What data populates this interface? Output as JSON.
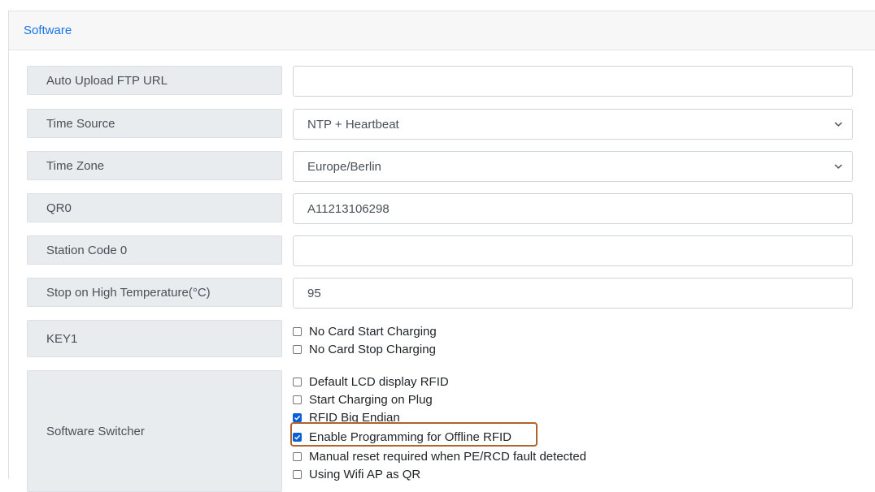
{
  "header": {
    "title": "Software"
  },
  "fields": {
    "ftp": {
      "label": "Auto Upload FTP URL",
      "value": ""
    },
    "time_source": {
      "label": "Time Source",
      "value": "NTP + Heartbeat"
    },
    "time_zone": {
      "label": "Time Zone",
      "value": "Europe/Berlin"
    },
    "qr0": {
      "label": "QR0",
      "value": "A11213106298"
    },
    "station_code": {
      "label": "Station Code 0",
      "value": ""
    },
    "stop_temp": {
      "label": "Stop on High Temperature(°C)",
      "value": "95"
    }
  },
  "key1": {
    "label": "KEY1",
    "options": [
      {
        "label": "No Card Start Charging",
        "checked": false
      },
      {
        "label": "No Card Stop Charging",
        "checked": false
      }
    ]
  },
  "switcher": {
    "label": "Software Switcher",
    "options": [
      {
        "label": "Default LCD display RFID",
        "checked": false
      },
      {
        "label": "Start Charging on Plug",
        "checked": false
      },
      {
        "label": "RFID Big Endian",
        "checked": true
      },
      {
        "label": "Enable Programming for Offline RFID",
        "checked": true
      },
      {
        "label": "Manual reset required when PE/RCD fault detected",
        "checked": false
      },
      {
        "label": "Using Wifi AP as QR",
        "checked": false
      }
    ]
  },
  "colors": {
    "accent": "#1a73e8",
    "checkbox_on": "#0b5fd6",
    "highlight": "#b0632c"
  }
}
